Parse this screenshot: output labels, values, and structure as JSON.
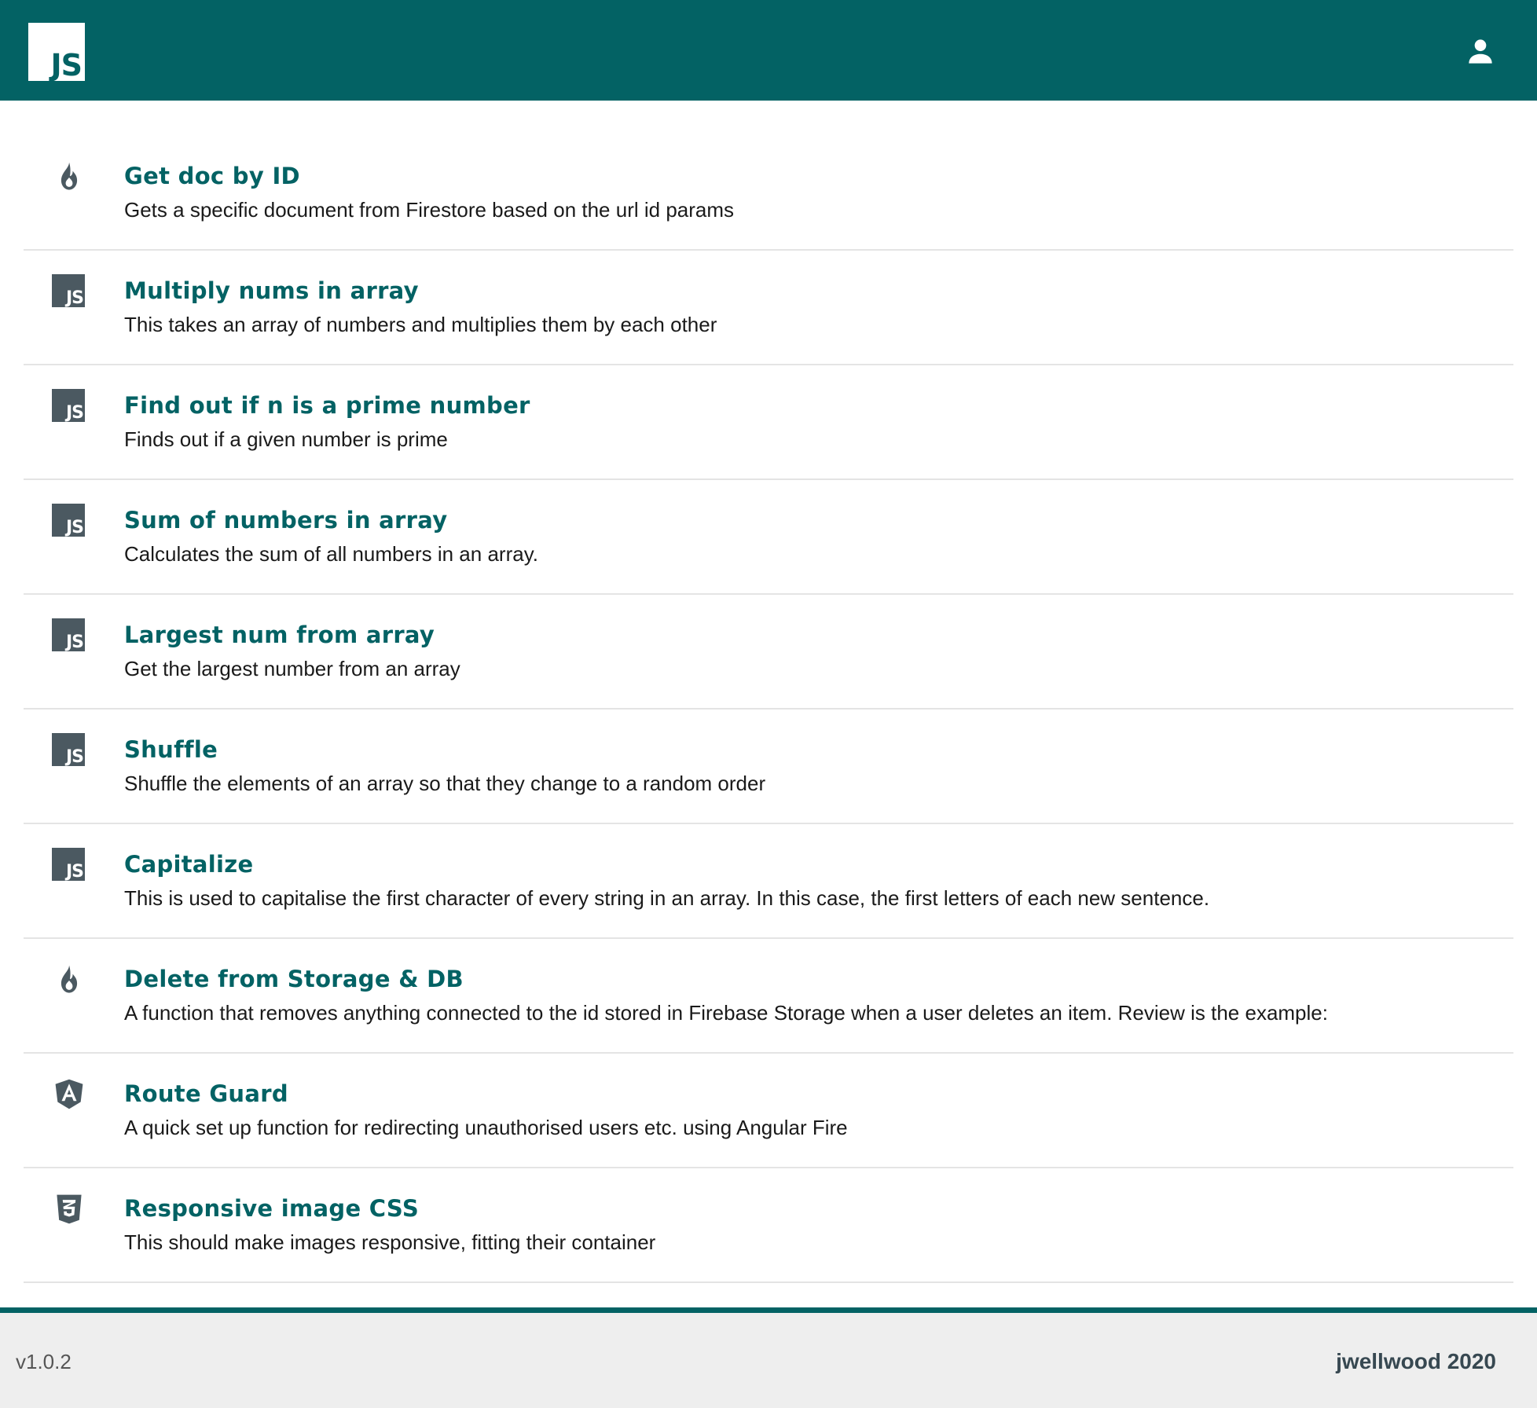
{
  "header": {
    "logo_text": "JS",
    "user_icon": "account-icon"
  },
  "colors": {
    "primary": "#036264",
    "icon_gray": "#4b5961",
    "footer_bg": "#eeeeee"
  },
  "items": [
    {
      "icon": "fire-icon",
      "title": "Get doc by ID",
      "desc": "Gets a specific document from  Firestore based on the url id params"
    },
    {
      "icon": "javascript-icon",
      "title": "Multiply nums in array",
      "desc": "This takes an array of numbers and multiplies them by each other"
    },
    {
      "icon": "javascript-icon",
      "title": "Find out if n is a prime number",
      "desc": "Finds out if a given number is prime"
    },
    {
      "icon": "javascript-icon",
      "title": "Sum of numbers in array",
      "desc": "Calculates the sum of all numbers in an array."
    },
    {
      "icon": "javascript-icon",
      "title": "Largest num from array",
      "desc": "Get the largest number from an array"
    },
    {
      "icon": "javascript-icon",
      "title": "Shuffle",
      "desc": "Shuffle the elements of an array so that they change to a random order"
    },
    {
      "icon": "javascript-icon",
      "title": "Capitalize",
      "desc": "This is used to capitalise the first character of every string in an array.  In this case, the first letters of each new sentence."
    },
    {
      "icon": "fire-icon",
      "title": "Delete from Storage & DB",
      "desc": "A function that removes anything connected to the id stored in  Firebase Storage when a user deletes an item.  Review is the example:"
    },
    {
      "icon": "angular-icon",
      "title": "Route Guard",
      "desc": "A quick set up function for redirecting unauthorised users etc. using Angular  Fire"
    },
    {
      "icon": "css3-icon",
      "title": "Responsive image CSS",
      "desc": "This should make images responsive, fitting their container"
    }
  ],
  "footer": {
    "version": "v1.0.2",
    "credit": "jwellwood 2020"
  }
}
